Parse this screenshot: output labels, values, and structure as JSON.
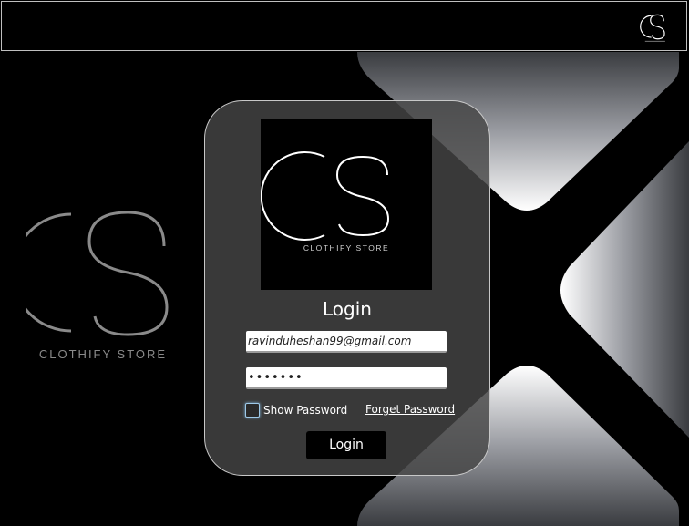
{
  "brand": {
    "name": "CLOTHIFY STORE"
  },
  "login": {
    "title": "Login",
    "email_value": "ravinduheshan99@gmail.com",
    "password_value": "•••••••",
    "show_password_label": "Show Password",
    "forget_password_label": "Forget Password",
    "login_button_label": "Login"
  },
  "colors": {
    "background": "#000000",
    "card": "#464646",
    "accent": "#ffffff"
  },
  "icons": {
    "top_logo": "cs-logo-icon",
    "checkbox": "checkbox-unchecked"
  }
}
